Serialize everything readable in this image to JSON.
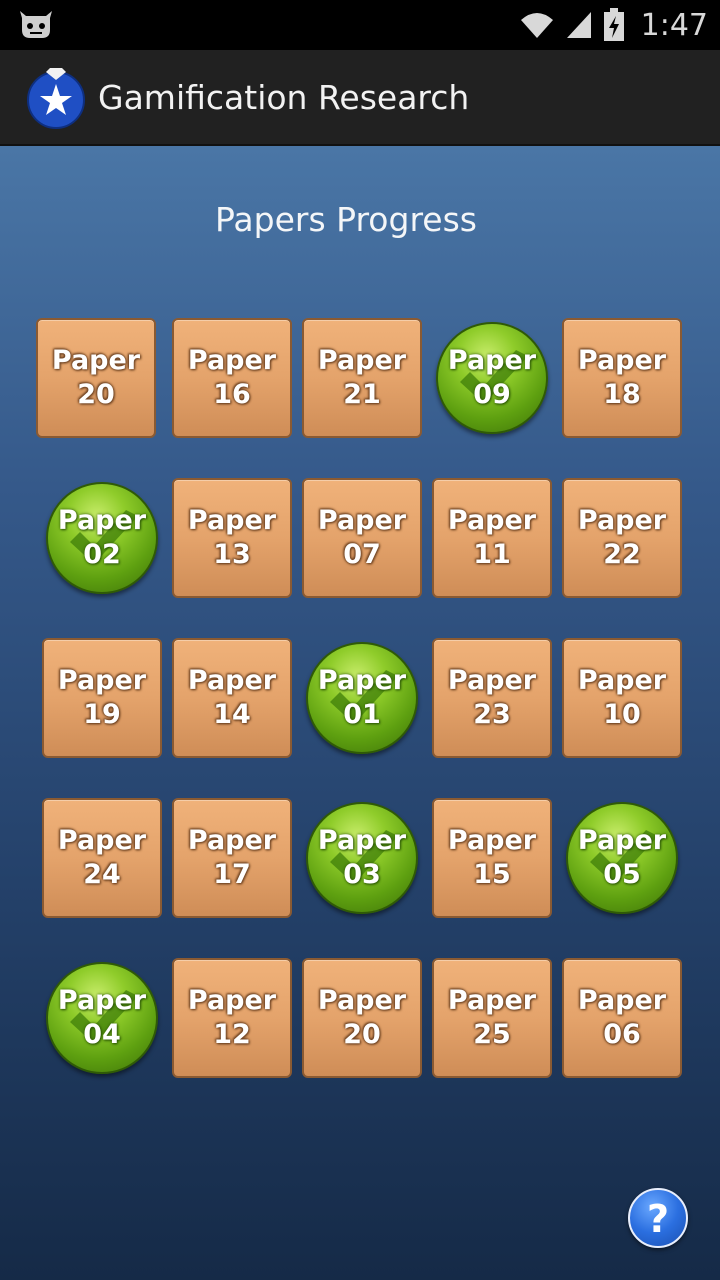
{
  "status_bar": {
    "time": "1:47",
    "icons": [
      "cyanogen-bot-icon",
      "wifi-icon",
      "signal-icon",
      "battery-charging-icon"
    ]
  },
  "app_bar": {
    "title": "Gamification Research",
    "logo_icon": "star-medal-icon"
  },
  "screen": {
    "heading": "Papers Progress"
  },
  "papers": [
    {
      "label": "Paper",
      "number": "20",
      "completed": false
    },
    {
      "label": "Paper",
      "number": "16",
      "completed": false
    },
    {
      "label": "Paper",
      "number": "21",
      "completed": false
    },
    {
      "label": "Paper",
      "number": "09",
      "completed": true
    },
    {
      "label": "Paper",
      "number": "18",
      "completed": false
    },
    {
      "label": "Paper",
      "number": "02",
      "completed": true
    },
    {
      "label": "Paper",
      "number": "13",
      "completed": false
    },
    {
      "label": "Paper",
      "number": "07",
      "completed": false
    },
    {
      "label": "Paper",
      "number": "11",
      "completed": false
    },
    {
      "label": "Paper",
      "number": "22",
      "completed": false
    },
    {
      "label": "Paper",
      "number": "19",
      "completed": false
    },
    {
      "label": "Paper",
      "number": "14",
      "completed": false
    },
    {
      "label": "Paper",
      "number": "01",
      "completed": true
    },
    {
      "label": "Paper",
      "number": "23",
      "completed": false
    },
    {
      "label": "Paper",
      "number": "10",
      "completed": false
    },
    {
      "label": "Paper",
      "number": "24",
      "completed": false
    },
    {
      "label": "Paper",
      "number": "17",
      "completed": false
    },
    {
      "label": "Paper",
      "number": "03",
      "completed": true
    },
    {
      "label": "Paper",
      "number": "15",
      "completed": false
    },
    {
      "label": "Paper",
      "number": "05",
      "completed": true
    },
    {
      "label": "Paper",
      "number": "04",
      "completed": true
    },
    {
      "label": "Paper",
      "number": "12",
      "completed": false
    },
    {
      "label": "Paper",
      "number": "20",
      "completed": false
    },
    {
      "label": "Paper",
      "number": "25",
      "completed": false
    },
    {
      "label": "Paper",
      "number": "06",
      "completed": false
    }
  ],
  "help_button": {
    "label": "?",
    "icon": "help-icon"
  },
  "colors": {
    "tile": "#e4a36b",
    "completed": "#6cb418",
    "app_bar": "#212121",
    "background_top": "#4a76a6",
    "background_bottom": "#152a47"
  }
}
